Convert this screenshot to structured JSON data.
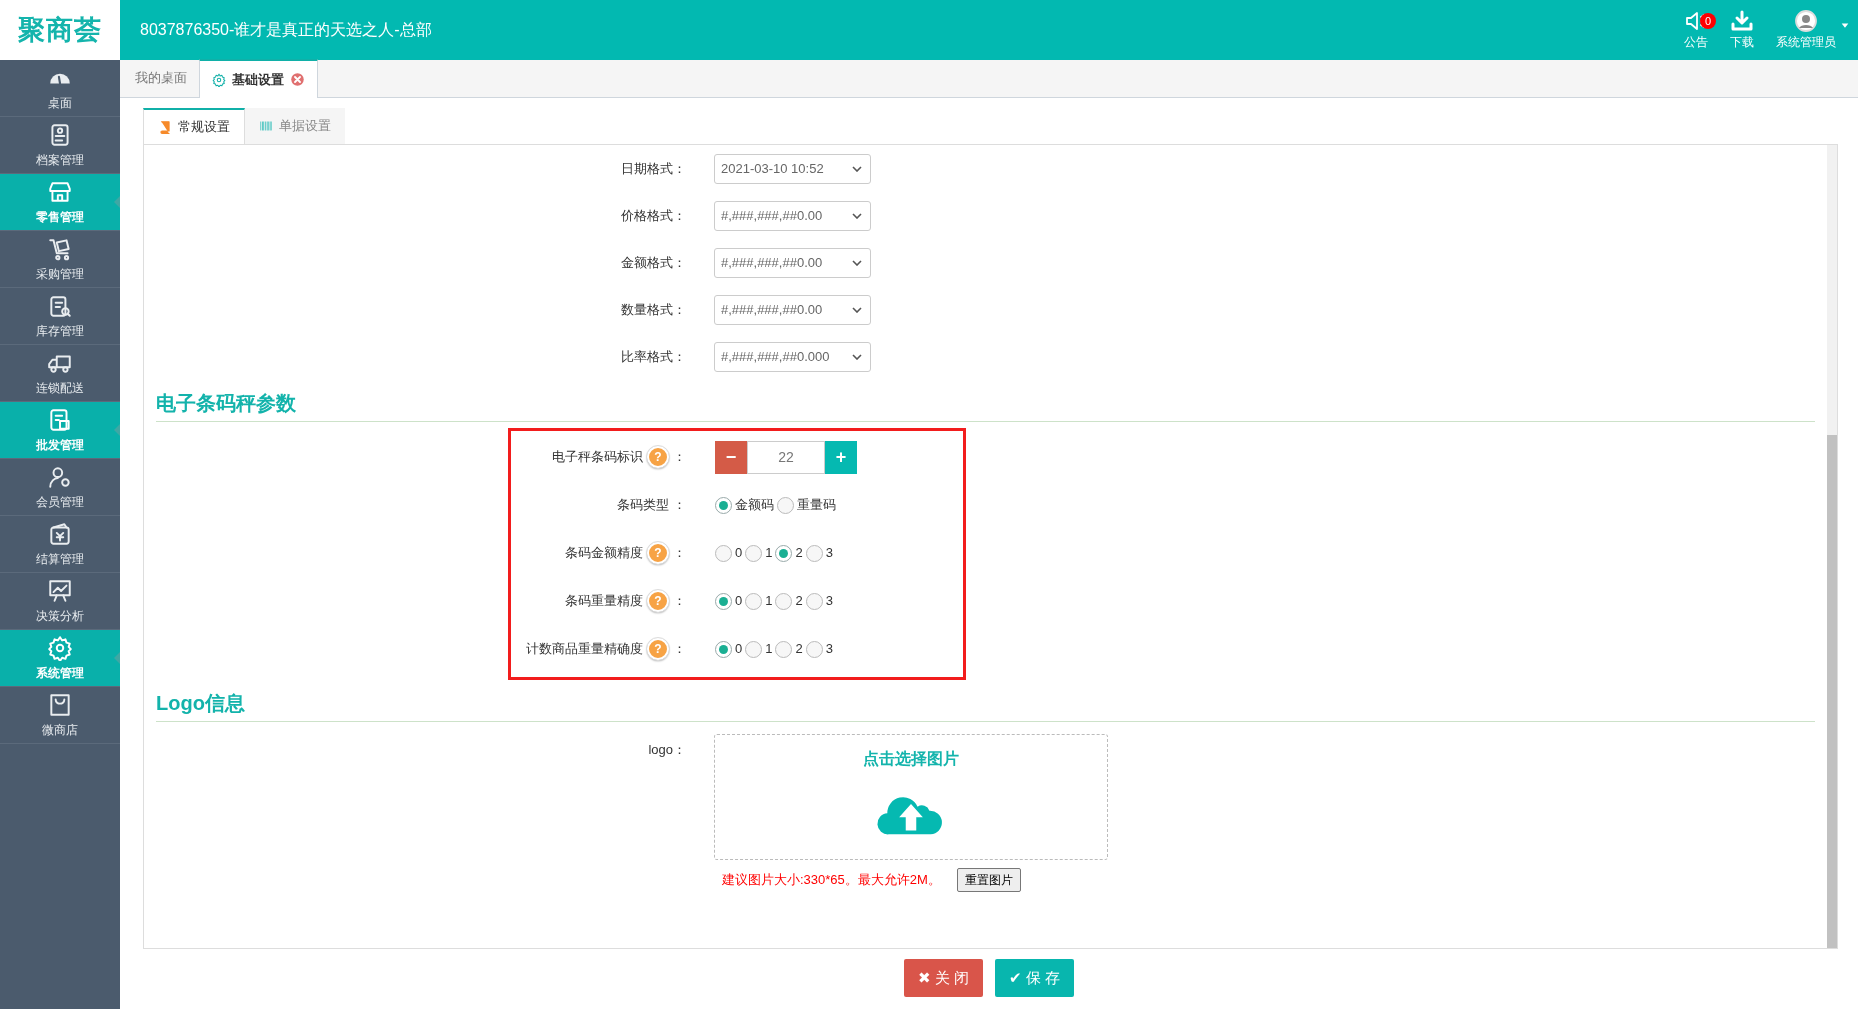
{
  "header": {
    "logo": "聚商荟",
    "title": "8037876350-谁才是真正的天选之人-总部",
    "actions": [
      {
        "label": "公告",
        "badge": "0"
      },
      {
        "label": "下载"
      },
      {
        "label": "系统管理员"
      }
    ]
  },
  "sidebar": {
    "items": [
      {
        "label": "桌面",
        "selected": false
      },
      {
        "label": "档案管理",
        "selected": false
      },
      {
        "label": "零售管理",
        "selected": true
      },
      {
        "label": "采购管理",
        "selected": false
      },
      {
        "label": "库存管理",
        "selected": false
      },
      {
        "label": "连锁配送",
        "selected": false
      },
      {
        "label": "批发管理",
        "selected": true
      },
      {
        "label": "会员管理",
        "selected": false
      },
      {
        "label": "结算管理",
        "selected": false
      },
      {
        "label": "决策分析",
        "selected": false
      },
      {
        "label": "系统管理",
        "selected": true
      },
      {
        "label": "微商店",
        "selected": false
      }
    ]
  },
  "tabs": [
    {
      "label": "我的桌面",
      "selected": false,
      "closable": false
    },
    {
      "label": "基础设置",
      "selected": true,
      "closable": true
    }
  ],
  "subtabs": [
    {
      "label": "常规设置",
      "selected": true
    },
    {
      "label": "单据设置",
      "selected": false
    }
  ],
  "format_fields": [
    {
      "label": "日期格式：",
      "value": "2021-03-10 10:52"
    },
    {
      "label": "价格格式：",
      "value": "#,###,###,##0.00"
    },
    {
      "label": "金额格式：",
      "value": "#,###,###,##0.00"
    },
    {
      "label": "数量格式：",
      "value": "#,###,###,##0.00"
    },
    {
      "label": "比率格式：",
      "value": "#,###,###,##0.000"
    }
  ],
  "scale_section": {
    "title": "电子条码秤参数",
    "highlighted": true,
    "help_mark": "?",
    "rows": [
      {
        "kind": "stepper",
        "label": "电子秤条码标识",
        "help": true,
        "colon": "：",
        "minus": "−",
        "value": "22",
        "plus": "+"
      },
      {
        "kind": "radio",
        "label": "条码类型",
        "help": false,
        "colon": "：",
        "options": [
          {
            "label": "金额码",
            "selected": true
          },
          {
            "label": "重量码",
            "selected": false
          }
        ]
      },
      {
        "kind": "radio",
        "label": "条码金额精度",
        "help": true,
        "colon": "：",
        "options": [
          {
            "label": "0",
            "selected": false
          },
          {
            "label": "1",
            "selected": false
          },
          {
            "label": "2",
            "selected": true
          },
          {
            "label": "3",
            "selected": false
          }
        ]
      },
      {
        "kind": "radio",
        "label": "条码重量精度",
        "help": true,
        "colon": "：",
        "options": [
          {
            "label": "0",
            "selected": true
          },
          {
            "label": "1",
            "selected": false
          },
          {
            "label": "2",
            "selected": false
          },
          {
            "label": "3",
            "selected": false
          }
        ]
      },
      {
        "kind": "radio",
        "label": "计数商品重量精确度",
        "help": true,
        "colon": "：",
        "options": [
          {
            "label": "0",
            "selected": true
          },
          {
            "label": "1",
            "selected": false
          },
          {
            "label": "2",
            "selected": false
          },
          {
            "label": "3",
            "selected": false
          }
        ]
      }
    ]
  },
  "logo_section": {
    "title": "Logo信息",
    "label": "logo：",
    "upload_text": "点击选择图片",
    "hint": "建议图片大小:330*65。最大允许2M。",
    "reset_button": "重置图片"
  },
  "footer_buttons": [
    {
      "kind": "close",
      "icon": "✖",
      "label": "关 闭"
    },
    {
      "kind": "save",
      "icon": "✔",
      "label": "保 存"
    }
  ]
}
